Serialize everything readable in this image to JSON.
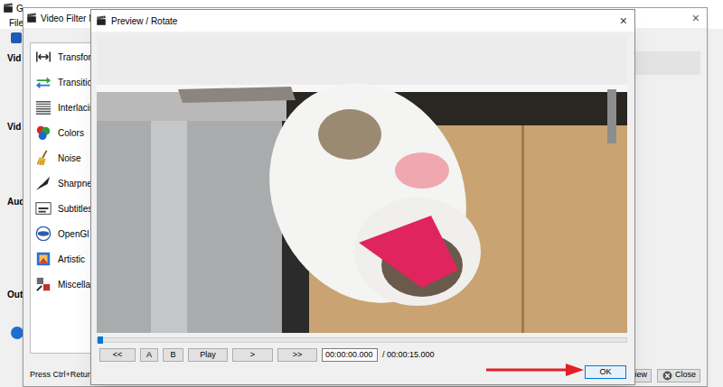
{
  "app": {
    "title": "G",
    "menu": [
      "File"
    ],
    "sections": [
      "Vid",
      "Vid",
      "Aud",
      "Out"
    ]
  },
  "filter_manager": {
    "title": "Video Filter Mana",
    "close": "×",
    "categories": [
      "Transform",
      "Transition",
      "Interlacing",
      "Colors",
      "Noise",
      "Sharpness",
      "Subtitles",
      "OpenGl",
      "Artistic",
      "Miscellaneo"
    ],
    "hint": "Press Ctrl+Return to ac",
    "buttons": [
      "view",
      "Close"
    ]
  },
  "preview": {
    "title": "Preview / Rotate",
    "close": "×",
    "seek": {
      "level": 0
    },
    "controls": [
      "<<",
      "A",
      "B",
      "Play",
      ">",
      ">>"
    ],
    "time": "00:00:00.000",
    "duration": "/ 00:00:15.000",
    "ok": "OK"
  }
}
